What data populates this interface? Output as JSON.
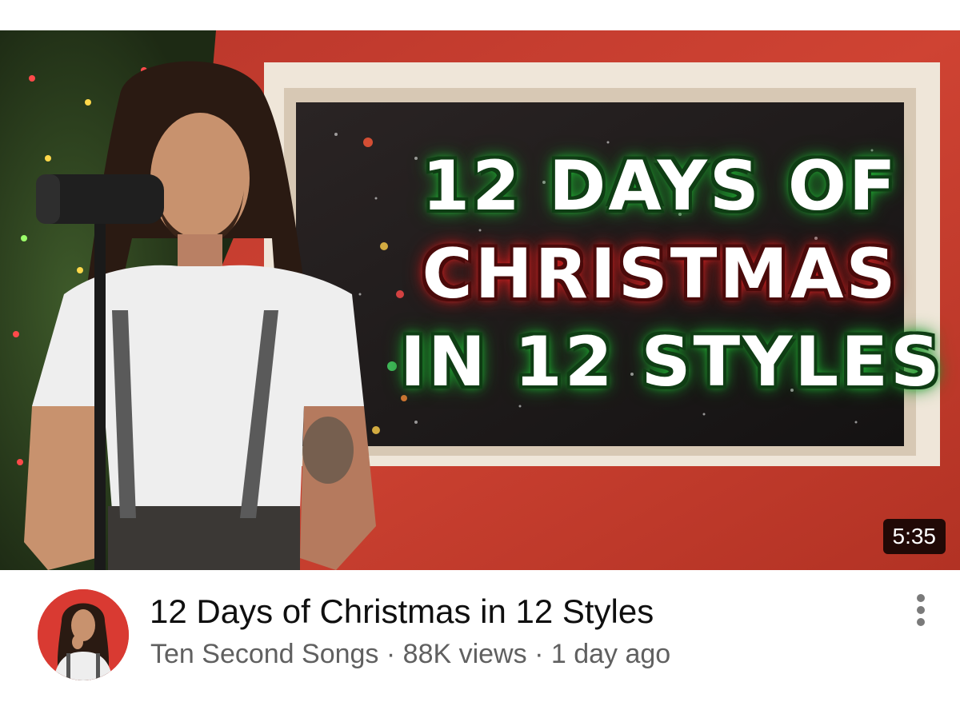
{
  "thumbnail": {
    "headline_lines": [
      "12 DAYS OF",
      "CHRISTMAS",
      "IN 12 STYLES"
    ],
    "duration": "5:35"
  },
  "video": {
    "title": "12 Days of Christmas in 12 Styles",
    "channel": "Ten Second Songs",
    "separator": " · ",
    "views": "88K views",
    "age": "1 day ago"
  },
  "icons": {
    "more": "more-vert-icon",
    "avatar": "channel-avatar"
  },
  "colors": {
    "title_text": "#0f0f0f",
    "meta_text": "#606060",
    "duration_bg": "#000000",
    "thumbnail_wall": "#c0392b",
    "headline_green_glow": "#27c23a",
    "headline_red_glow": "#e82a2a"
  }
}
